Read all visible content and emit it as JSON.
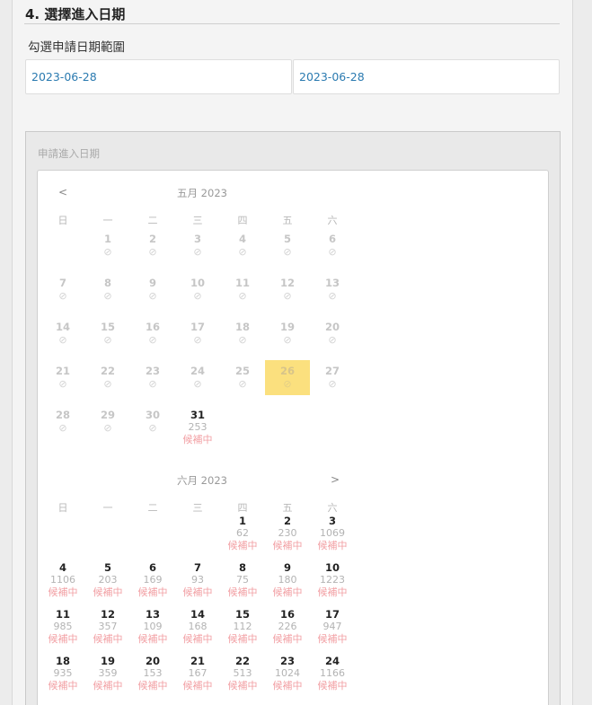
{
  "step": {
    "title": "4. 選擇進入日期",
    "range_label": "勾選申請日期範圍",
    "date_from": "2023-06-28",
    "date_to": "2023-06-28"
  },
  "picker": {
    "label": "申請進入日期",
    "prev_label": "<",
    "next_label": ">",
    "weekdays": [
      "日",
      "一",
      "二",
      "三",
      "四",
      "五",
      "六"
    ],
    "highlight_color": "#fbe07e",
    "status_color": "#f2a0a4",
    "disabled_icon": "⊘",
    "months": [
      {
        "title": "五月 2023",
        "first_weekday": 1,
        "today": 26,
        "days": [
          {
            "d": "1",
            "state": "disabled"
          },
          {
            "d": "2",
            "state": "disabled"
          },
          {
            "d": "3",
            "state": "disabled"
          },
          {
            "d": "4",
            "state": "disabled"
          },
          {
            "d": "5",
            "state": "disabled"
          },
          {
            "d": "6",
            "state": "disabled"
          },
          {
            "d": "7",
            "state": "disabled"
          },
          {
            "d": "8",
            "state": "disabled"
          },
          {
            "d": "9",
            "state": "disabled"
          },
          {
            "d": "10",
            "state": "disabled"
          },
          {
            "d": "11",
            "state": "disabled"
          },
          {
            "d": "12",
            "state": "disabled"
          },
          {
            "d": "13",
            "state": "disabled"
          },
          {
            "d": "14",
            "state": "disabled"
          },
          {
            "d": "15",
            "state": "disabled"
          },
          {
            "d": "16",
            "state": "disabled"
          },
          {
            "d": "17",
            "state": "disabled"
          },
          {
            "d": "18",
            "state": "disabled"
          },
          {
            "d": "19",
            "state": "disabled"
          },
          {
            "d": "20",
            "state": "disabled"
          },
          {
            "d": "21",
            "state": "disabled"
          },
          {
            "d": "22",
            "state": "disabled"
          },
          {
            "d": "23",
            "state": "disabled"
          },
          {
            "d": "24",
            "state": "disabled"
          },
          {
            "d": "25",
            "state": "disabled"
          },
          {
            "d": "26",
            "state": "disabled"
          },
          {
            "d": "27",
            "state": "disabled"
          },
          {
            "d": "28",
            "state": "disabled"
          },
          {
            "d": "29",
            "state": "disabled"
          },
          {
            "d": "30",
            "state": "disabled"
          },
          {
            "d": "31",
            "state": "avail",
            "count": "253",
            "status": "候補中"
          }
        ]
      },
      {
        "title": "六月 2023",
        "first_weekday": 4,
        "days": [
          {
            "d": "1",
            "state": "avail",
            "count": "62",
            "status": "候補中"
          },
          {
            "d": "2",
            "state": "avail",
            "count": "230",
            "status": "候補中"
          },
          {
            "d": "3",
            "state": "avail",
            "count": "1069",
            "status": "候補中"
          },
          {
            "d": "4",
            "state": "avail",
            "count": "1106",
            "status": "候補中"
          },
          {
            "d": "5",
            "state": "avail",
            "count": "203",
            "status": "候補中"
          },
          {
            "d": "6",
            "state": "avail",
            "count": "169",
            "status": "候補中"
          },
          {
            "d": "7",
            "state": "avail",
            "count": "93",
            "status": "候補中"
          },
          {
            "d": "8",
            "state": "avail",
            "count": "75",
            "status": "候補中"
          },
          {
            "d": "9",
            "state": "avail",
            "count": "180",
            "status": "候補中"
          },
          {
            "d": "10",
            "state": "avail",
            "count": "1223",
            "status": "候補中"
          },
          {
            "d": "11",
            "state": "avail",
            "count": "985",
            "status": "候補中"
          },
          {
            "d": "12",
            "state": "avail",
            "count": "357",
            "status": "候補中"
          },
          {
            "d": "13",
            "state": "avail",
            "count": "109",
            "status": "候補中"
          },
          {
            "d": "14",
            "state": "avail",
            "count": "168",
            "status": "候補中"
          },
          {
            "d": "15",
            "state": "avail",
            "count": "112",
            "status": "候補中"
          },
          {
            "d": "16",
            "state": "avail",
            "count": "226",
            "status": "候補中"
          },
          {
            "d": "17",
            "state": "avail",
            "count": "947",
            "status": "候補中"
          },
          {
            "d": "18",
            "state": "avail",
            "count": "935",
            "status": "候補中"
          },
          {
            "d": "19",
            "state": "avail",
            "count": "359",
            "status": "候補中"
          },
          {
            "d": "20",
            "state": "avail",
            "count": "153",
            "status": "候補中"
          },
          {
            "d": "21",
            "state": "avail",
            "count": "167",
            "status": "候補中"
          },
          {
            "d": "22",
            "state": "avail",
            "count": "513",
            "status": "候補中"
          },
          {
            "d": "23",
            "state": "avail",
            "count": "1024",
            "status": "候補中"
          },
          {
            "d": "24",
            "state": "avail",
            "count": "1166",
            "status": "候補中"
          }
        ]
      }
    ]
  }
}
